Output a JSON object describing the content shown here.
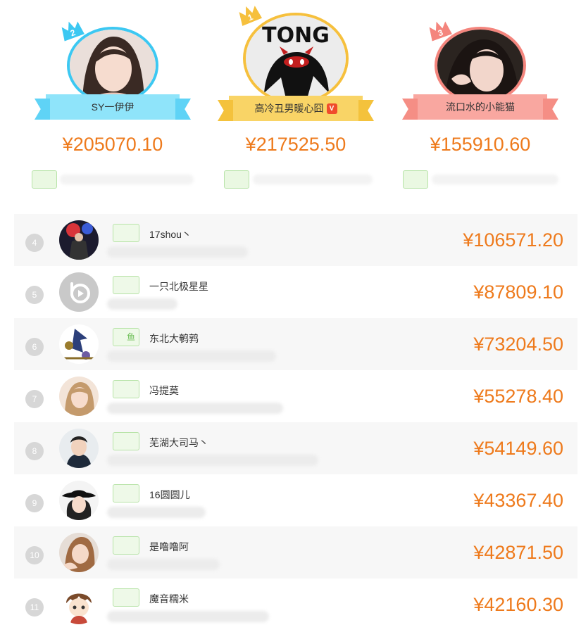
{
  "podium": [
    {
      "place": "2",
      "name": "SY一伊伊",
      "amount": "¥205070.10",
      "verified": false
    },
    {
      "place": "1",
      "name": "高冷丑男暖心囧",
      "amount": "¥217525.50",
      "verified": true,
      "avatar_text": "TONG"
    },
    {
      "place": "3",
      "name": "流口水的小能猫",
      "amount": "¥155910.60",
      "verified": false
    }
  ],
  "ranking": [
    {
      "rank": "4",
      "name": "17shou丶",
      "amount": "¥106571.20",
      "level": ""
    },
    {
      "rank": "5",
      "name": "一只北极星星",
      "amount": "¥87809.10",
      "level": ""
    },
    {
      "rank": "6",
      "name": "东北大鹌鹑",
      "amount": "¥73204.50",
      "level": "鱼"
    },
    {
      "rank": "7",
      "name": "冯提莫",
      "amount": "¥55278.40",
      "level": ""
    },
    {
      "rank": "8",
      "name": "芜湖大司马丶",
      "amount": "¥54149.60",
      "level": ""
    },
    {
      "rank": "9",
      "name": "16圆圆儿",
      "amount": "¥43367.40",
      "level": ""
    },
    {
      "rank": "10",
      "name": "是噜噜阿",
      "amount": "¥42871.50",
      "level": ""
    },
    {
      "rank": "11",
      "name": "魔音糯米",
      "amount": "¥42160.30",
      "level": ""
    }
  ],
  "colors": {
    "accent": "#ee7a1c",
    "rank2": "#3cc8f2",
    "rank1": "#f6c03d",
    "rank3": "#f4857d",
    "level_green": "#b7e3a7"
  },
  "icons": {
    "crown": "crown-icon",
    "verified": "verified-icon",
    "default_avatar": "default-avatar-icon"
  }
}
